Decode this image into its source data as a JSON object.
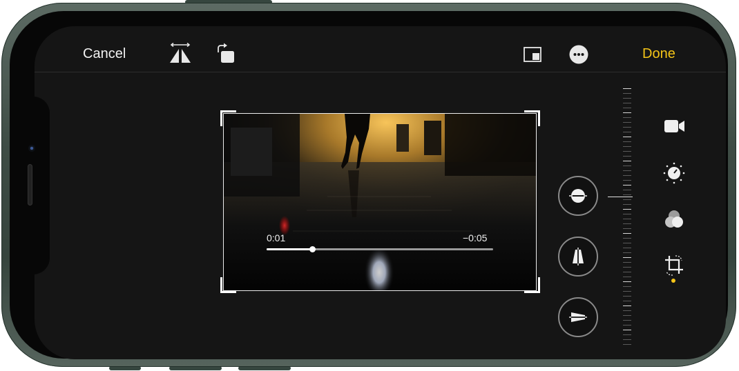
{
  "toolbar": {
    "cancel_label": "Cancel",
    "done_label": "Done"
  },
  "video": {
    "elapsed": "0:01",
    "remaining": "−0:05",
    "progress": 0.2
  },
  "adjustments": [
    {
      "icon": "straighten-icon"
    },
    {
      "icon": "vertical-perspective-icon"
    },
    {
      "icon": "horizontal-perspective-icon"
    }
  ],
  "modes": [
    {
      "icon": "video-camera-icon"
    },
    {
      "icon": "adjust-dial-icon"
    },
    {
      "icon": "filters-icon"
    },
    {
      "icon": "crop-rotate-icon",
      "active": true
    }
  ],
  "colors": {
    "accent": "#f5c518",
    "background": "#151515"
  }
}
